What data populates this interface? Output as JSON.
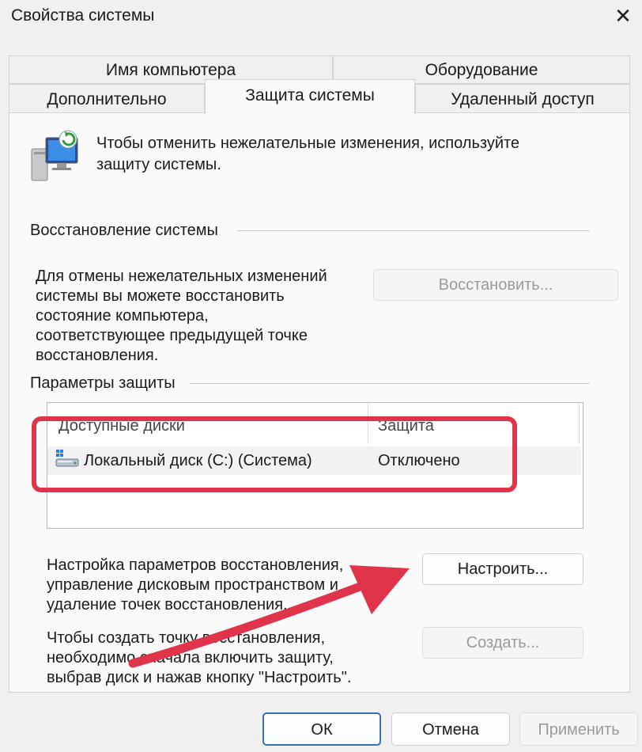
{
  "window": {
    "title": "Свойства системы",
    "close": "✕"
  },
  "tabs": {
    "row1": [
      "Имя компьютера",
      "Оборудование"
    ],
    "row2": [
      "Дополнительно",
      "Защита системы",
      "Удаленный доступ"
    ],
    "active": "Защита системы"
  },
  "intro": {
    "text_line1": "Чтобы отменить нежелательные изменения, используйте",
    "text_line2": "защиту системы."
  },
  "restore": {
    "group_label": "Восстановление системы",
    "description": [
      "Для отмены нежелательных изменений",
      "системы вы можете восстановить",
      "состояние компьютера,",
      "соответствующее предыдущей точке",
      "восстановления."
    ],
    "button": "Восстановить..."
  },
  "protection": {
    "group_label": "Параметры защиты",
    "columns": [
      "Доступные диски",
      "Защита"
    ],
    "rows": [
      {
        "drive": "Локальный диск (C:) (Система)",
        "status": "Отключено"
      }
    ]
  },
  "configure": {
    "description": [
      "Настройка параметров восстановления,",
      "управление дисковым пространством и",
      "удаление точек восстановления."
    ],
    "button": "Настроить..."
  },
  "create": {
    "description": [
      "Чтобы создать точку восстановления,",
      "необходимо сначала включить защиту,",
      "выбрав диск и нажав кнопку \"Настроить\"."
    ],
    "button": "Создать..."
  },
  "footer": {
    "ok": "ОК",
    "cancel": "Отмена",
    "apply": "Применить"
  },
  "colors": {
    "highlight": "#e0344a",
    "accent": "#3a6fb5"
  }
}
